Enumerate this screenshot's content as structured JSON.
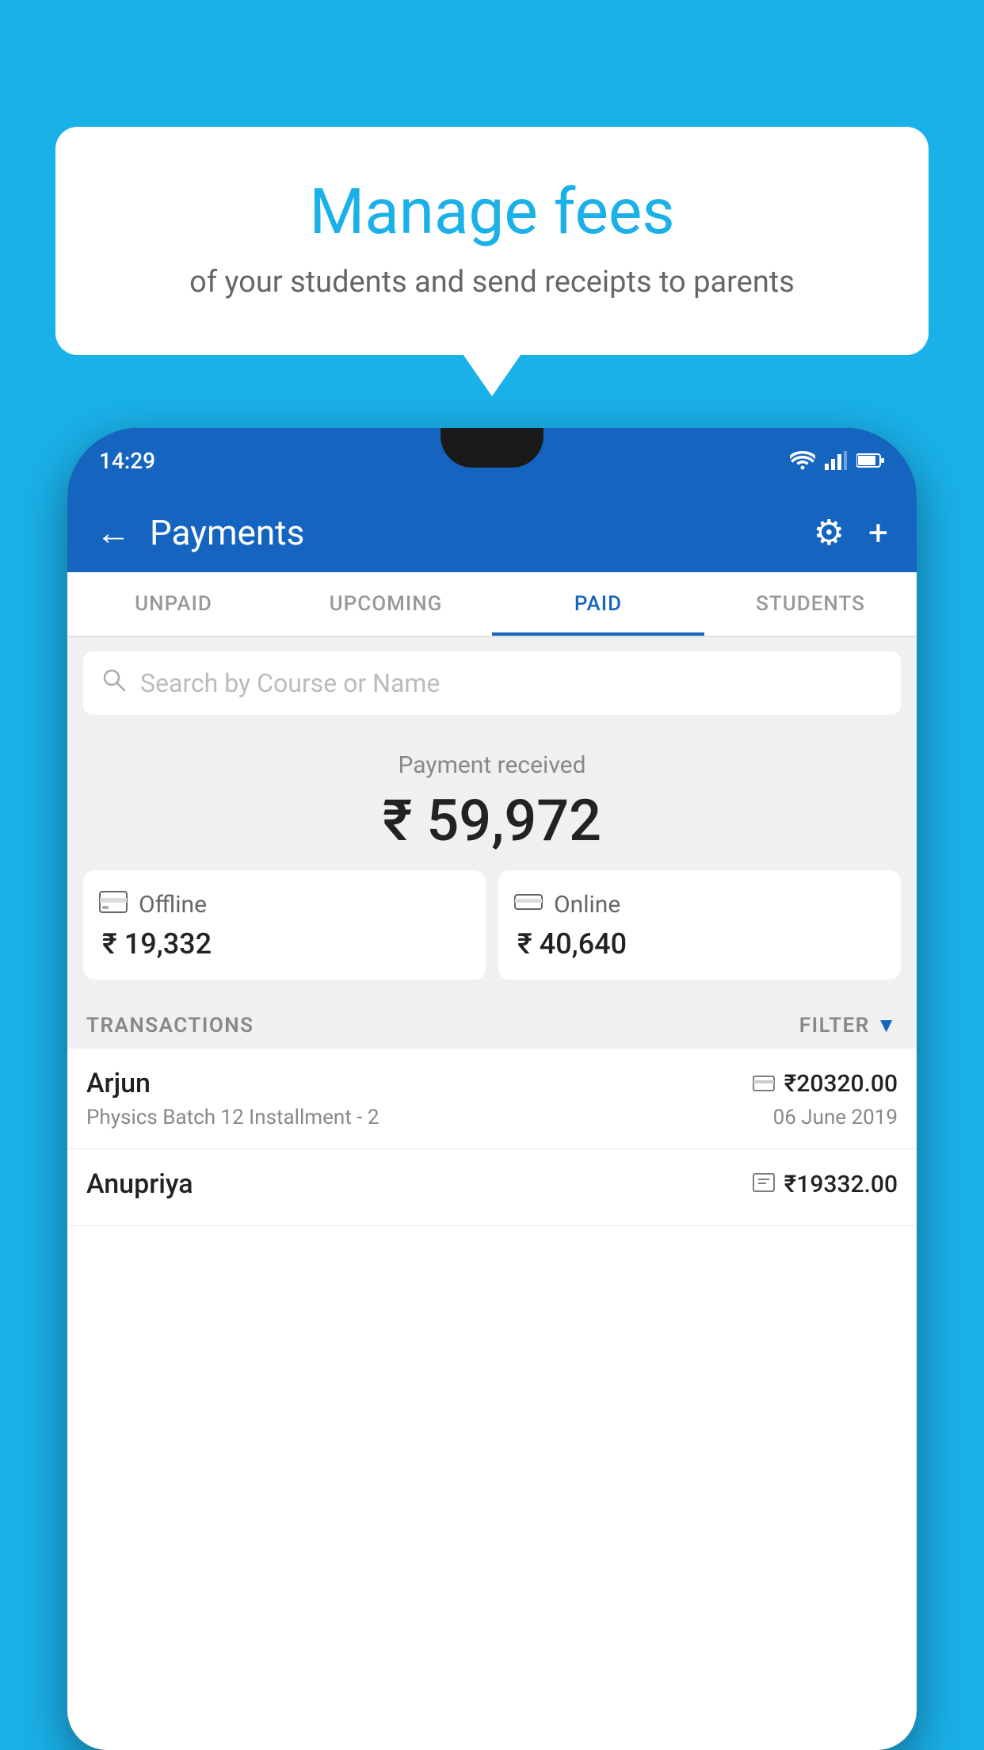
{
  "background_color": "#1ab0e8",
  "bubble": {
    "title": "Manage fees",
    "subtitle": "of your students and send receipts to parents"
  },
  "phone": {
    "status_bar": {
      "time": "14:29"
    },
    "top_bar": {
      "title": "Payments",
      "back_label": "←",
      "gear_label": "⚙",
      "plus_label": "+"
    },
    "tabs": [
      {
        "label": "UNPAID",
        "active": false
      },
      {
        "label": "UPCOMING",
        "active": false
      },
      {
        "label": "PAID",
        "active": true
      },
      {
        "label": "STUDENTS",
        "active": false
      }
    ],
    "search": {
      "placeholder": "Search by Course or Name",
      "icon": "🔍"
    },
    "payment_received": {
      "label": "Payment received",
      "amount": "₹ 59,972",
      "offline": {
        "label": "Offline",
        "amount": "₹ 19,332"
      },
      "online": {
        "label": "Online",
        "amount": "₹ 40,640"
      }
    },
    "transactions": {
      "label": "TRANSACTIONS",
      "filter_label": "FILTER",
      "items": [
        {
          "name": "Arjun",
          "amount": "₹20320.00",
          "description": "Physics Batch 12 Installment - 2",
          "date": "06 June 2019",
          "payment_type": "card"
        },
        {
          "name": "Anupriya",
          "amount": "₹19332.00",
          "description": "",
          "date": "",
          "payment_type": "offline"
        }
      ]
    }
  }
}
